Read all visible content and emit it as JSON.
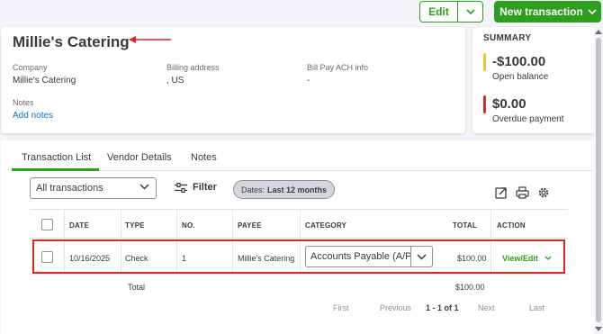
{
  "header": {
    "edit_label": "Edit",
    "new_transaction_label": "New transaction"
  },
  "vendor": {
    "name": "Millie's Catering",
    "company_label": "Company",
    "company_value": "Millie's Catering",
    "billing_label": "Billing address",
    "billing_value": ", US",
    "ach_label": "Bill Pay ACH info",
    "ach_value": "-",
    "notes_label": "Notes",
    "add_notes": "Add notes"
  },
  "summary": {
    "title": "SUMMARY",
    "open_balance_amount": "-$100.00",
    "open_balance_label": "Open balance",
    "overdue_amount": "$0.00",
    "overdue_label": "Overdue payment",
    "open_color": "#f2c12e",
    "overdue_color": "#d52b1e"
  },
  "tabs": [
    "Transaction List",
    "Vendor Details",
    "Notes"
  ],
  "toolbar": {
    "type_select": "All transactions",
    "filter_label": "Filter",
    "dates_prefix": "Dates:",
    "dates_value": "Last 12 months"
  },
  "table": {
    "columns": [
      "DATE",
      "TYPE",
      "NO.",
      "PAYEE",
      "CATEGORY",
      "TOTAL",
      "ACTION"
    ],
    "rows": [
      {
        "date": "10/16/2025",
        "type": "Check",
        "no": "1",
        "payee": "Millie's Catering",
        "category": "Accounts Payable (A/P)",
        "total": "$100.00",
        "action": "View/Edit"
      }
    ],
    "total_label": "Total",
    "total_value": "$100.00"
  },
  "pagination": {
    "first": "First",
    "previous": "Previous",
    "range": "1 - 1 of 1",
    "next": "Next",
    "last": "Last"
  },
  "colors": {
    "brand_green": "#2ca01c",
    "link_blue": "#0077c5",
    "annotation_red": "#d52b1e"
  }
}
